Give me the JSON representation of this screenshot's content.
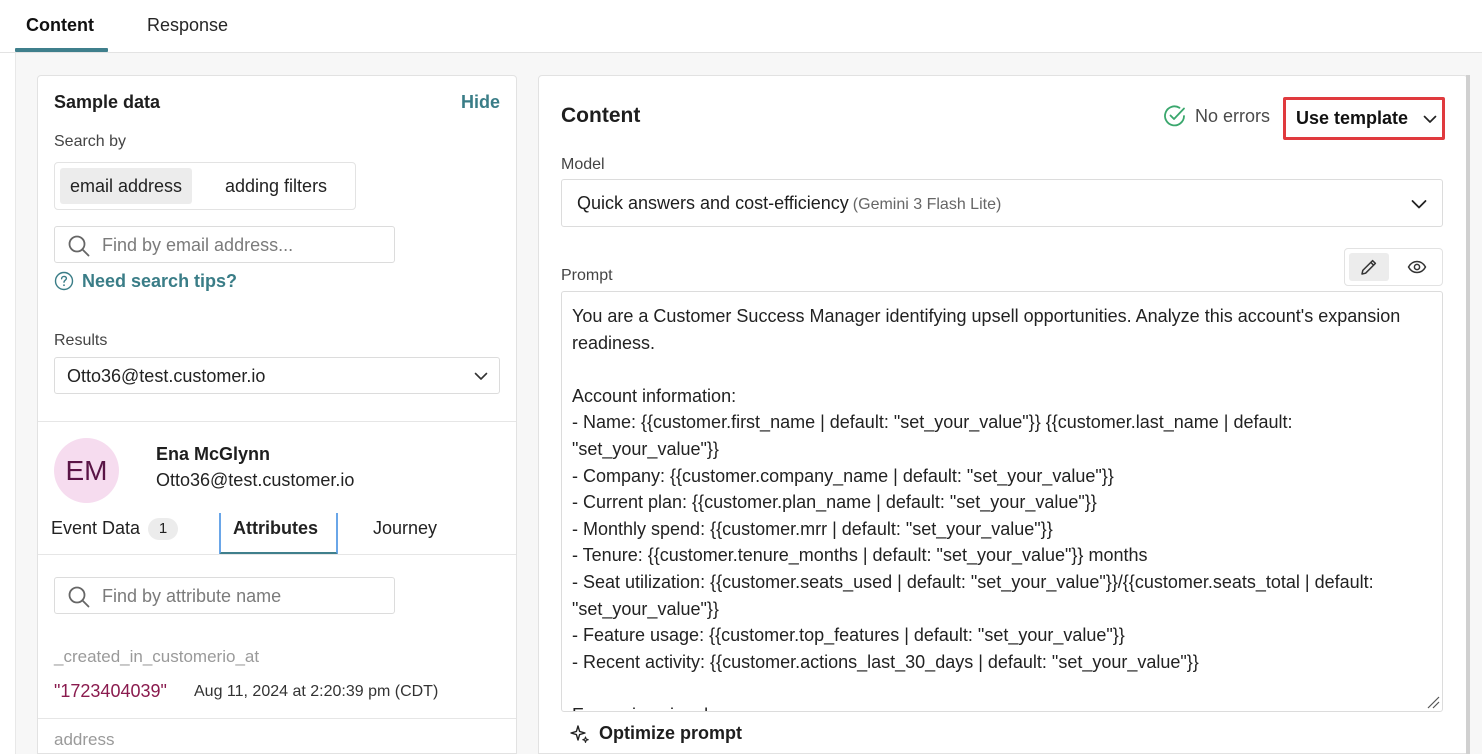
{
  "tabs": {
    "content": "Content",
    "response": "Response"
  },
  "sample_data": {
    "title": "Sample data",
    "hide": "Hide",
    "search_by_label": "Search by",
    "search_by_options": [
      "email address",
      "adding filters"
    ],
    "search_placeholder": "Find by email address...",
    "search_tips": "Need search tips?",
    "results_label": "Results",
    "results_value": "Otto36@test.customer.io",
    "profile": {
      "initials": "EM",
      "name": "Ena McGlynn",
      "email": "Otto36@test.customer.io"
    },
    "sub_tabs": {
      "event_data": "Event Data",
      "event_data_count": "1",
      "attributes": "Attributes",
      "journey": "Journey"
    },
    "attribute_search_placeholder": "Find by attribute name",
    "attributes": [
      {
        "name": "_created_in_customerio_at",
        "value": "\"1723404039\"",
        "formatted": "Aug 11, 2024 at 2:20:39 pm (CDT)"
      },
      {
        "name": "address"
      }
    ]
  },
  "content_panel": {
    "title": "Content",
    "status": "No errors",
    "use_template": "Use template",
    "model_label": "Model",
    "model_value": "Quick answers and cost-efficiency",
    "model_sub": "(Gemini 3 Flash Lite)",
    "prompt_label": "Prompt",
    "prompt_text": "You are a Customer Success Manager identifying upsell opportunities. Analyze this account's expansion readiness.\n\nAccount information:\n- Name: {{customer.first_name | default: \"set_your_value\"}} {{customer.last_name | default: \"set_your_value\"}}\n- Company: {{customer.company_name | default: \"set_your_value\"}}\n- Current plan: {{customer.plan_name | default: \"set_your_value\"}}\n- Monthly spend: {{customer.mrr | default: \"set_your_value\"}}\n- Tenure: {{customer.tenure_months | default: \"set_your_value\"}} months\n- Seat utilization: {{customer.seats_used | default: \"set_your_value\"}}/{{customer.seats_total | default: \"set_your_value\"}}\n- Feature usage: {{customer.top_features | default: \"set_your_value\"}}\n- Recent activity: {{customer.actions_last_30_days | default: \"set_your_value\"}}\n\nExpansion signals:",
    "optimize": "Optimize prompt"
  },
  "colors": {
    "accent_teal": "#3a7d87",
    "highlight_red": "#e03a3e",
    "success_green": "#3aa76d",
    "avatar_bg": "#f6dcef",
    "attr_value": "#8a1b4e"
  },
  "icons": [
    "search-icon",
    "question-circle-icon",
    "chevron-down-icon",
    "check-circle-icon",
    "pencil-icon",
    "eye-icon",
    "sparkle-icon",
    "resize-handle-icon"
  ]
}
